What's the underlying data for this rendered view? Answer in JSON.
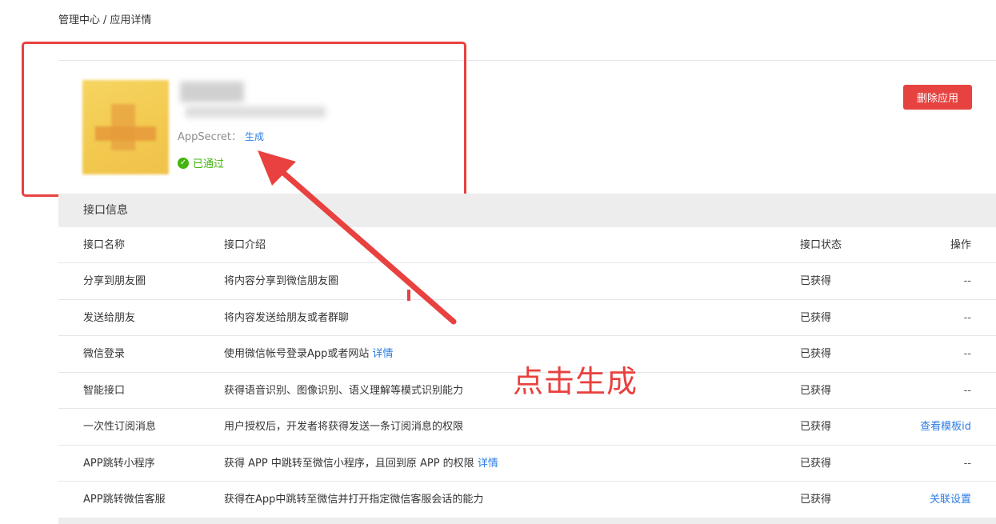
{
  "breadcrumb": {
    "root": "管理中心",
    "separator": "/",
    "current": "应用详情"
  },
  "app": {
    "appsecret_label": "AppSecret：",
    "appsecret_action": "生成",
    "status": "已通过",
    "delete_button": "删除应用"
  },
  "section": {
    "title": "接口信息"
  },
  "table": {
    "headers": [
      "接口名称",
      "接口介绍",
      "接口状态",
      "操作"
    ],
    "rows": [
      {
        "name": "分享到朋友圈",
        "desc": "将内容分享到微信朋友圈",
        "link": "",
        "status": "已获得",
        "action": "--"
      },
      {
        "name": "发送给朋友",
        "desc": "将内容发送给朋友或者群聊",
        "link": "",
        "status": "已获得",
        "action": "--"
      },
      {
        "name": "微信登录",
        "desc": "使用微信帐号登录App或者网站",
        "link": "详情",
        "status": "已获得",
        "action": "--"
      },
      {
        "name": "智能接口",
        "desc": "获得语音识别、图像识别、语义理解等模式识别能力",
        "link": "",
        "status": "已获得",
        "action": "--"
      },
      {
        "name": "一次性订阅消息",
        "desc": "用户授权后，开发者将获得发送一条订阅消息的权限",
        "link": "",
        "status": "已获得",
        "action": "查看模板id"
      },
      {
        "name": "APP跳转小程序",
        "desc": "获得 APP 中跳转至微信小程序，且回到原 APP 的权限",
        "link": "详情",
        "status": "已获得",
        "action": "--"
      },
      {
        "name": "APP跳转微信客服",
        "desc": "获得在App中跳转至微信并打开指定微信客服会话的能力",
        "link": "",
        "status": "已获得",
        "action": "关联设置"
      }
    ]
  },
  "annotation": {
    "text": "点击生成"
  },
  "colors": {
    "accent_red": "#e8413f",
    "link_blue": "#2e7de3",
    "success_green": "#45b40e",
    "delete_red": "#e64340"
  }
}
